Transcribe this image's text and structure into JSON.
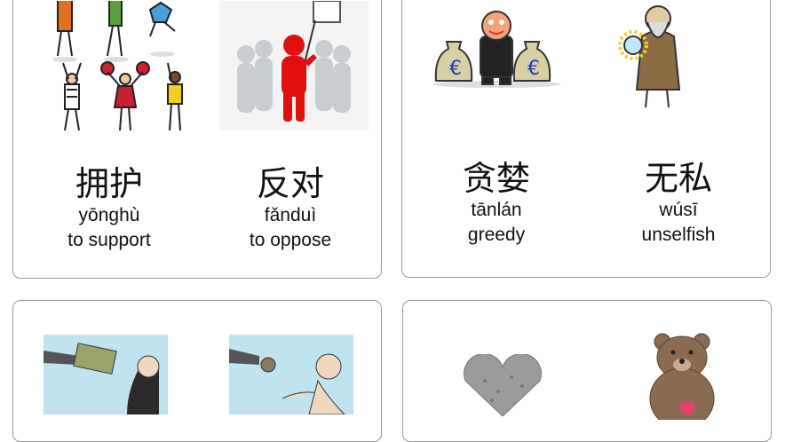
{
  "cards": [
    {
      "items": [
        {
          "hanzi": "拥护",
          "pinyin": "yōnghù",
          "english": "to support",
          "image": "cheering-crowd-illustration"
        },
        {
          "hanzi": "反对",
          "pinyin": "fǎnduì",
          "english": "to oppose",
          "image": "red-protester-figure-illustration"
        }
      ]
    },
    {
      "items": [
        {
          "hanzi": "贪婪",
          "pinyin": "tānlán",
          "english": "greedy",
          "image": "man-with-money-bags-illustration",
          "symbols": [
            "€",
            "€"
          ]
        },
        {
          "hanzi": "无私",
          "pinyin": "wúsī",
          "english": "unselfish",
          "image": "old-sage-with-crystal-ball-illustration"
        }
      ]
    },
    {
      "items": [
        {
          "image": "hand-giving-money-cartoon"
        },
        {
          "image": "hand-giving-coin-cartoon"
        }
      ]
    },
    {
      "items": [
        {
          "image": "stone-heart-illustration"
        },
        {
          "image": "bear-holding-heart-illustration"
        }
      ]
    }
  ]
}
